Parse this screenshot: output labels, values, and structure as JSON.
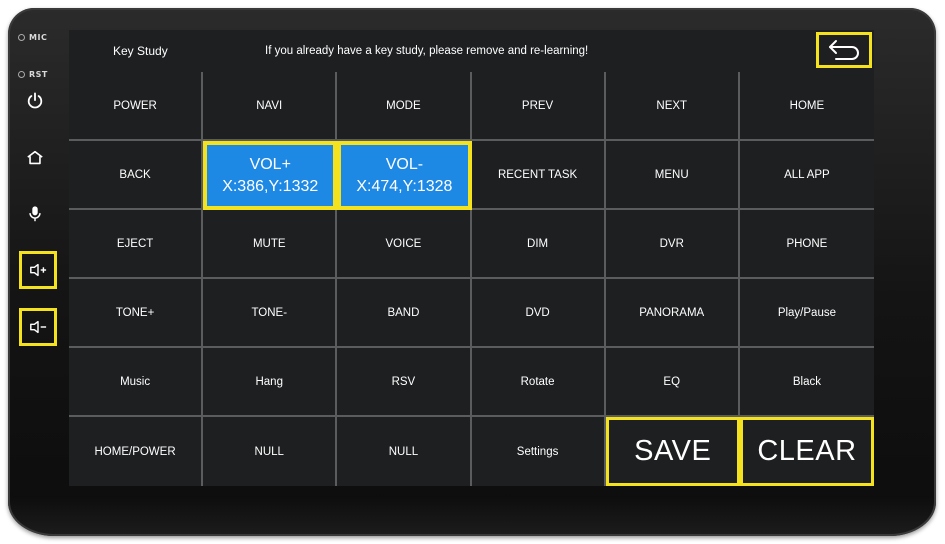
{
  "side_panel": {
    "mic_label": "MIC",
    "rst_label": "RST",
    "buttons": [
      {
        "icon": "power-icon"
      },
      {
        "icon": "home-icon"
      },
      {
        "icon": "microphone-icon"
      },
      {
        "icon": "volume-up-icon"
      },
      {
        "icon": "volume-down-icon"
      }
    ]
  },
  "header": {
    "title": "Key Study",
    "notice": "If you already have a key study, please remove and re-learning!",
    "back_icon": "back-arrow-icon"
  },
  "keys": [
    [
      "POWER",
      "NAVI",
      "MODE",
      "PREV",
      "NEXT",
      "HOME"
    ],
    [
      "BACK",
      "VOL+",
      "VOL-",
      "RECENT TASK",
      "MENU",
      "ALL APP"
    ],
    [
      "EJECT",
      "MUTE",
      "VOICE",
      "DIM",
      "DVR",
      "PHONE"
    ],
    [
      "TONE+",
      "TONE-",
      "BAND",
      "DVD",
      "PANORAMA",
      "Play/Pause"
    ],
    [
      "Music",
      "Hang",
      "RSV",
      "Rotate",
      "EQ",
      "Black"
    ],
    [
      "HOME/POWER",
      "NULL",
      "NULL",
      "Settings",
      "SAVE",
      "CLEAR"
    ]
  ],
  "learned": {
    "vol_plus_coords": "X:386,Y:1332",
    "vol_minus_coords": "X:474,Y:1328"
  },
  "colors": {
    "highlight": "#f5e21f",
    "learned_bg": "#1e88e5",
    "screen_bg": "#1d1f21",
    "grid_line": "#5a5c5e"
  }
}
